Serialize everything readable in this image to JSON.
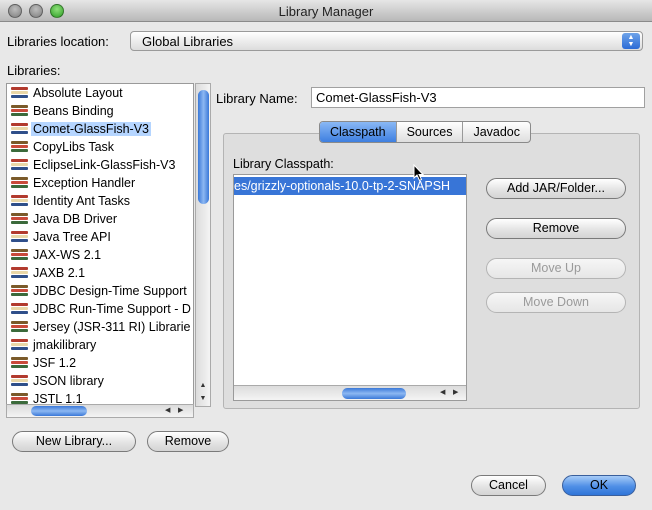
{
  "window": {
    "title": "Library Manager"
  },
  "location": {
    "label": "Libraries location:",
    "value": "Global Libraries"
  },
  "libraries": {
    "label": "Libraries:",
    "items": [
      "Absolute Layout",
      "Beans Binding",
      "Comet-GlassFish-V3",
      "CopyLibs Task",
      "EclipseLink-GlassFish-V3",
      "Exception Handler",
      "Identity Ant Tasks",
      "Java DB Driver",
      "Java Tree API",
      "JAX-WS 2.1",
      "JAXB 2.1",
      "JDBC Design-Time Support",
      "JDBC Run-Time Support - D",
      "Jersey (JSR-311 RI) Librarie",
      "jmakilibrary",
      "JSF 1.2",
      "JSON library",
      "JSTL 1.1"
    ],
    "selected_index": 2
  },
  "library_name": {
    "label": "Library Name:",
    "value": "Comet-GlassFish-V3"
  },
  "tabs": [
    {
      "label": "Classpath",
      "active": true
    },
    {
      "label": "Sources",
      "active": false
    },
    {
      "label": "Javadoc",
      "active": false
    }
  ],
  "classpath": {
    "label": "Library Classpath:",
    "entries": [
      "es/grizzly-optionals-10.0-tp-2-SNAPSH"
    ]
  },
  "side_buttons": {
    "add_jar": "Add JAR/Folder...",
    "remove": "Remove",
    "move_up": "Move Up",
    "move_down": "Move Down"
  },
  "bottom_buttons": {
    "new_library": "New Library...",
    "remove": "Remove",
    "cancel": "Cancel",
    "ok": "OK"
  },
  "colors": {
    "selection_blue": "#3875d7",
    "list_selection": "#b5d5ff",
    "window_bg": "#e8e8e8"
  }
}
